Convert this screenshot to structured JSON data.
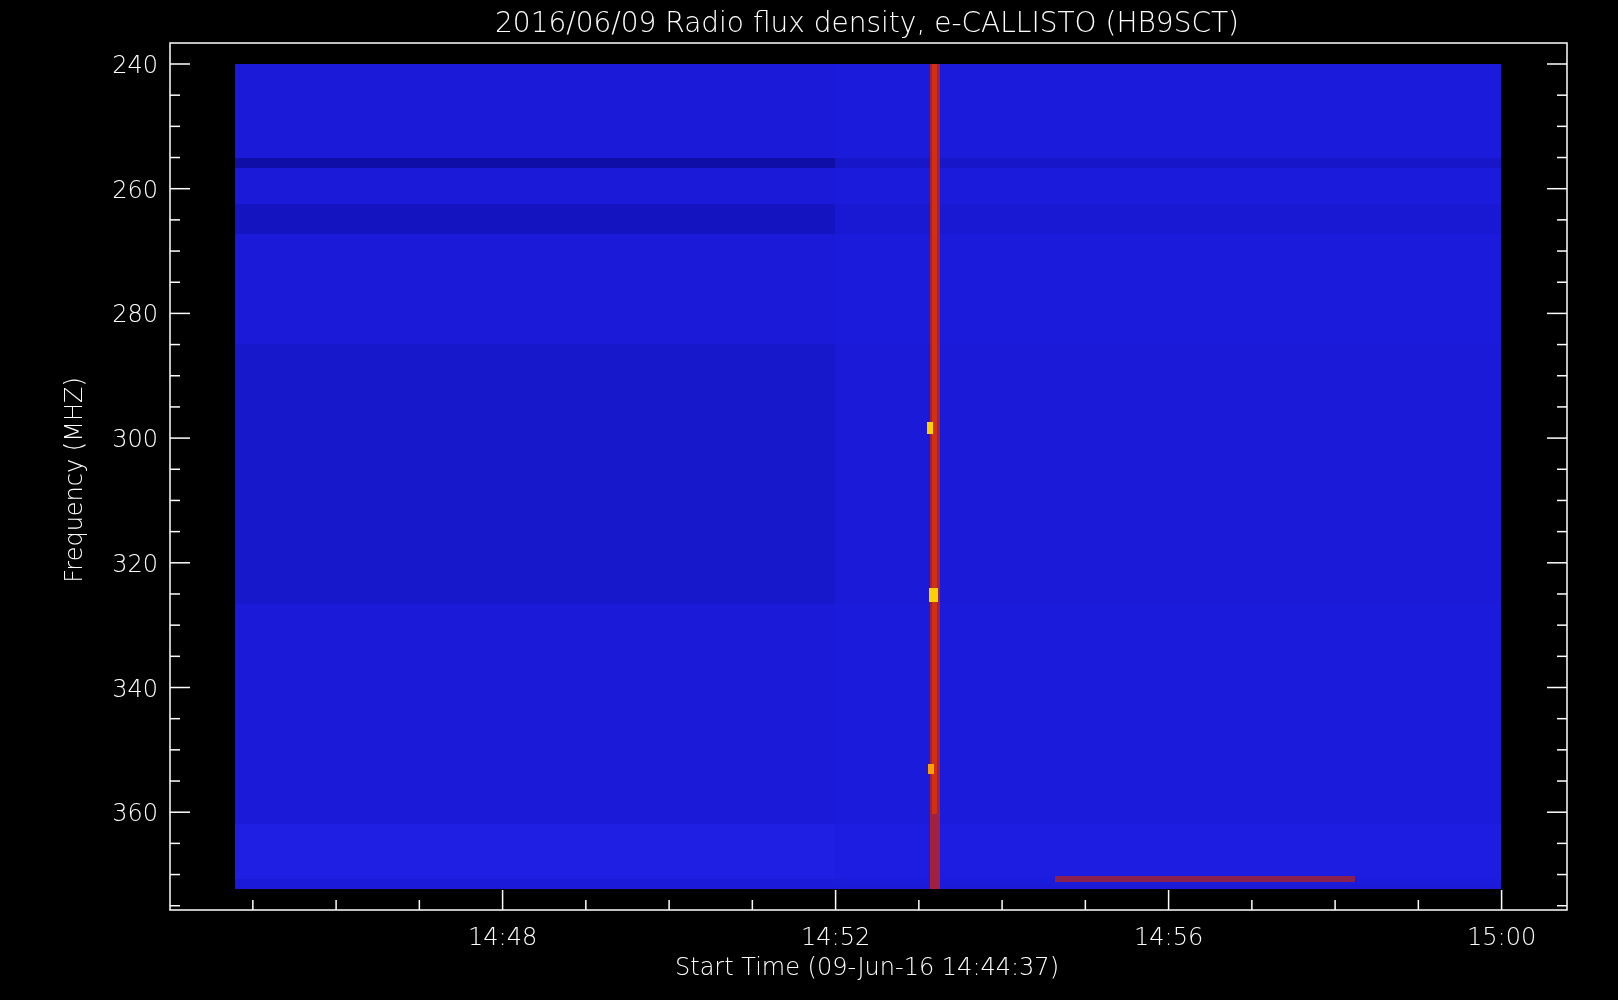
{
  "title": "2016/06/09  Radio flux density, e-CALLISTO (HB9SCT)",
  "y_axis": {
    "label": "Frequency (MHZ)",
    "ticks": [
      "240",
      "260",
      "280",
      "300",
      "320",
      "340",
      "360"
    ]
  },
  "x_axis": {
    "label": "Start Time (09-Jun-16 14:44:37)",
    "ticks": [
      "14:48",
      "14:52",
      "14:56",
      "15:00"
    ]
  }
}
